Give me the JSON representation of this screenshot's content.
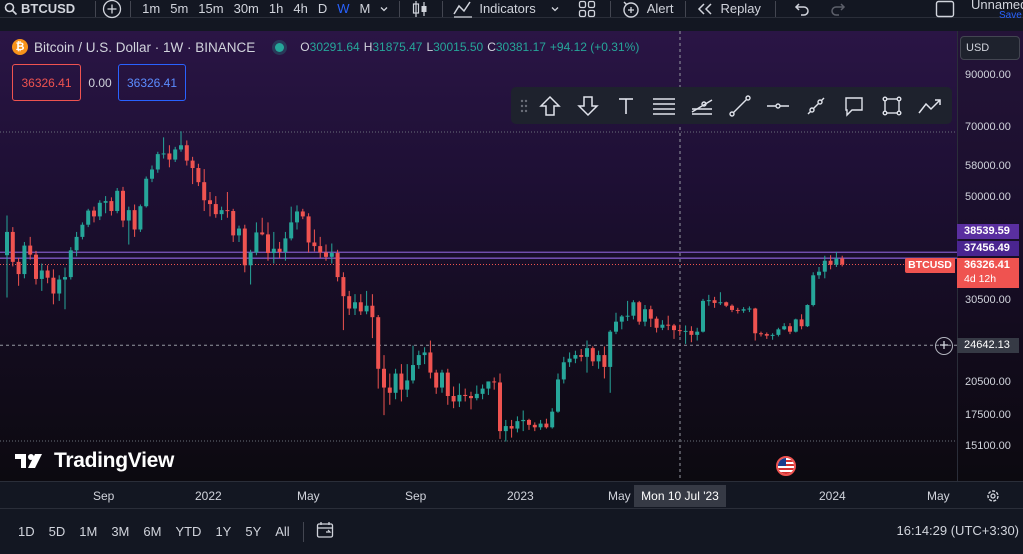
{
  "toolbar": {
    "symbol": "BTCUSD",
    "intervals": [
      "1m",
      "5m",
      "15m",
      "30m",
      "1h",
      "4h",
      "D",
      "W",
      "M"
    ],
    "active_interval": "W",
    "indicators_label": "Indicators",
    "alert_label": "Alert",
    "replay_label": "Replay",
    "layout_name": "Unnamed",
    "save_label": "Save"
  },
  "legend": {
    "coin_glyph": "₿",
    "title": "Bitcoin / U.S. Dollar · 1W · BINANCE",
    "open_key": "O",
    "open": "30291.64",
    "high_key": "H",
    "high": "31875.47",
    "low_key": "L",
    "low": "30015.50",
    "close_key": "C",
    "close": "30381.17",
    "change": "+94.12 (+0.31%)"
  },
  "order": {
    "sell": "36326.41",
    "spread": "0.00",
    "buy": "36326.41"
  },
  "currency": "USD",
  "price_axis": {
    "labels": [
      "90000.00",
      "70000.00",
      "58000.00",
      "50000.00",
      "30500.00",
      "20500.00",
      "17500.00",
      "15100.00"
    ],
    "tag_upper": "38539.59",
    "tag_lower": "37456.49",
    "tag_symbol": "BTCUSD",
    "tag_price": "36326.41",
    "tag_countdown": "4d 12h",
    "crosshair_price": "24642.13"
  },
  "brand": "TradingView",
  "time_axis": {
    "labels": [
      "Sep",
      "2022",
      "May",
      "Sep",
      "2023",
      "May",
      "2024",
      "May"
    ],
    "crosshair_label": "Mon 10 Jul '23"
  },
  "bottom": {
    "ranges": [
      "1D",
      "5D",
      "1M",
      "3M",
      "6M",
      "YTD",
      "1Y",
      "5Y",
      "All"
    ],
    "clock": "16:14:29 (UTC+3:30)"
  },
  "colors": {
    "up": "#26a69a",
    "down": "#ef5350",
    "accent": "#2962ff",
    "level_line": "#7e57c2"
  },
  "chart_data": {
    "type": "candlestick",
    "symbol": "BTCUSD",
    "interval": "1W",
    "scale": "log",
    "ylim": [
      15100,
      90000
    ],
    "candles": [
      {
        "o": 38000,
        "h": 46000,
        "l": 31000,
        "c": 42500
      },
      {
        "o": 42500,
        "h": 43500,
        "l": 36000,
        "c": 36800
      },
      {
        "o": 36800,
        "h": 37500,
        "l": 32800,
        "c": 34700
      },
      {
        "o": 34700,
        "h": 40500,
        "l": 34000,
        "c": 39800
      },
      {
        "o": 39800,
        "h": 41500,
        "l": 37200,
        "c": 38100
      },
      {
        "o": 38100,
        "h": 38800,
        "l": 33000,
        "c": 33900
      },
      {
        "o": 33900,
        "h": 36500,
        "l": 32000,
        "c": 35300
      },
      {
        "o": 35300,
        "h": 36200,
        "l": 33200,
        "c": 34100
      },
      {
        "o": 34100,
        "h": 35500,
        "l": 30000,
        "c": 31600
      },
      {
        "o": 31600,
        "h": 34500,
        "l": 30500,
        "c": 33800
      },
      {
        "o": 33800,
        "h": 35800,
        "l": 29300,
        "c": 34200
      },
      {
        "o": 34200,
        "h": 39500,
        "l": 33800,
        "c": 38900
      },
      {
        "o": 38900,
        "h": 42500,
        "l": 37800,
        "c": 41500
      },
      {
        "o": 41500,
        "h": 44500,
        "l": 41000,
        "c": 44000
      },
      {
        "o": 44000,
        "h": 47500,
        "l": 43500,
        "c": 47100
      },
      {
        "o": 47100,
        "h": 48000,
        "l": 44500,
        "c": 45800
      },
      {
        "o": 45800,
        "h": 49500,
        "l": 45000,
        "c": 48900
      },
      {
        "o": 48900,
        "h": 50500,
        "l": 46500,
        "c": 49300
      },
      {
        "o": 49300,
        "h": 50200,
        "l": 46000,
        "c": 47000
      },
      {
        "o": 47000,
        "h": 52500,
        "l": 46500,
        "c": 51800
      },
      {
        "o": 51800,
        "h": 52800,
        "l": 43500,
        "c": 44900
      },
      {
        "o": 44900,
        "h": 48000,
        "l": 40000,
        "c": 47200
      },
      {
        "o": 47200,
        "h": 48500,
        "l": 41500,
        "c": 43000
      },
      {
        "o": 43000,
        "h": 48500,
        "l": 42500,
        "c": 48100
      },
      {
        "o": 48100,
        "h": 55500,
        "l": 47800,
        "c": 54900
      },
      {
        "o": 54900,
        "h": 58500,
        "l": 54000,
        "c": 57400
      },
      {
        "o": 57400,
        "h": 62500,
        "l": 56500,
        "c": 61800
      },
      {
        "o": 61800,
        "h": 67000,
        "l": 60500,
        "c": 62000
      },
      {
        "o": 62000,
        "h": 64500,
        "l": 58000,
        "c": 60200
      },
      {
        "o": 60200,
        "h": 64000,
        "l": 59500,
        "c": 63200
      },
      {
        "o": 63200,
        "h": 69000,
        "l": 62500,
        "c": 64500
      },
      {
        "o": 64500,
        "h": 66000,
        "l": 58500,
        "c": 59900
      },
      {
        "o": 59900,
        "h": 61000,
        "l": 53500,
        "c": 57800
      },
      {
        "o": 57800,
        "h": 59000,
        "l": 53000,
        "c": 54000
      },
      {
        "o": 54000,
        "h": 57500,
        "l": 47000,
        "c": 49500
      },
      {
        "o": 49500,
        "h": 51500,
        "l": 45800,
        "c": 48600
      },
      {
        "o": 48600,
        "h": 50500,
        "l": 45500,
        "c": 46300
      },
      {
        "o": 46300,
        "h": 48000,
        "l": 45000,
        "c": 47200
      },
      {
        "o": 47200,
        "h": 51500,
        "l": 45500,
        "c": 47000
      },
      {
        "o": 47000,
        "h": 47500,
        "l": 40500,
        "c": 41800
      },
      {
        "o": 41800,
        "h": 43800,
        "l": 40500,
        "c": 43200
      },
      {
        "o": 43200,
        "h": 44000,
        "l": 35000,
        "c": 36200
      },
      {
        "o": 36200,
        "h": 39000,
        "l": 33000,
        "c": 38500
      },
      {
        "o": 38500,
        "h": 44500,
        "l": 38000,
        "c": 42400
      },
      {
        "o": 42400,
        "h": 45500,
        "l": 41800,
        "c": 42000
      },
      {
        "o": 42000,
        "h": 44500,
        "l": 37000,
        "c": 38400
      },
      {
        "o": 38400,
        "h": 42500,
        "l": 36500,
        "c": 39200
      },
      {
        "o": 39200,
        "h": 40500,
        "l": 37500,
        "c": 38600
      },
      {
        "o": 38600,
        "h": 42500,
        "l": 37000,
        "c": 41200
      },
      {
        "o": 41200,
        "h": 48000,
        "l": 40800,
        "c": 44500
      },
      {
        "o": 44500,
        "h": 48300,
        "l": 43000,
        "c": 46900
      },
      {
        "o": 46900,
        "h": 47500,
        "l": 45200,
        "c": 45800
      },
      {
        "o": 45800,
        "h": 46500,
        "l": 38500,
        "c": 40400
      },
      {
        "o": 40400,
        "h": 43000,
        "l": 38700,
        "c": 39700
      },
      {
        "o": 39700,
        "h": 41500,
        "l": 37500,
        "c": 38500
      },
      {
        "o": 38500,
        "h": 40000,
        "l": 37000,
        "c": 37700
      },
      {
        "o": 37700,
        "h": 40200,
        "l": 36500,
        "c": 38400
      },
      {
        "o": 38400,
        "h": 39000,
        "l": 33500,
        "c": 34200
      },
      {
        "o": 34200,
        "h": 35000,
        "l": 26500,
        "c": 31200
      },
      {
        "o": 31200,
        "h": 32000,
        "l": 28500,
        "c": 29400
      },
      {
        "o": 29400,
        "h": 31500,
        "l": 28500,
        "c": 30300
      },
      {
        "o": 30300,
        "h": 31500,
        "l": 28500,
        "c": 29000
      },
      {
        "o": 29000,
        "h": 32000,
        "l": 28600,
        "c": 29800
      },
      {
        "o": 29800,
        "h": 31500,
        "l": 25500,
        "c": 28200
      },
      {
        "o": 28200,
        "h": 28500,
        "l": 20000,
        "c": 22000
      },
      {
        "o": 22000,
        "h": 23500,
        "l": 17600,
        "c": 20100
      },
      {
        "o": 20100,
        "h": 21500,
        "l": 18500,
        "c": 19600
      },
      {
        "o": 19600,
        "h": 22000,
        "l": 19000,
        "c": 21500
      },
      {
        "o": 21500,
        "h": 22500,
        "l": 18800,
        "c": 19900
      },
      {
        "o": 19900,
        "h": 22500,
        "l": 19200,
        "c": 20800
      },
      {
        "o": 20800,
        "h": 24600,
        "l": 20500,
        "c": 22400
      },
      {
        "o": 22400,
        "h": 24000,
        "l": 22000,
        "c": 23500
      },
      {
        "o": 23500,
        "h": 24400,
        "l": 22500,
        "c": 23800
      },
      {
        "o": 23800,
        "h": 25200,
        "l": 21000,
        "c": 21600
      },
      {
        "o": 21600,
        "h": 21900,
        "l": 19500,
        "c": 20100
      },
      {
        "o": 20100,
        "h": 21900,
        "l": 19600,
        "c": 21600
      },
      {
        "o": 21600,
        "h": 22000,
        "l": 18500,
        "c": 19300
      },
      {
        "o": 19300,
        "h": 20200,
        "l": 18200,
        "c": 18800
      },
      {
        "o": 18800,
        "h": 20500,
        "l": 18300,
        "c": 19400
      },
      {
        "o": 19400,
        "h": 20000,
        "l": 18800,
        "c": 19300
      },
      {
        "o": 19300,
        "h": 19700,
        "l": 18100,
        "c": 19100
      },
      {
        "o": 19100,
        "h": 20300,
        "l": 18900,
        "c": 19500
      },
      {
        "o": 19500,
        "h": 20400,
        "l": 19000,
        "c": 20000
      },
      {
        "o": 20000,
        "h": 20700,
        "l": 19400,
        "c": 20700
      },
      {
        "o": 20700,
        "h": 21100,
        "l": 19900,
        "c": 20600
      },
      {
        "o": 20600,
        "h": 21500,
        "l": 15700,
        "c": 16300
      },
      {
        "o": 16300,
        "h": 17200,
        "l": 15500,
        "c": 16700
      },
      {
        "o": 16700,
        "h": 17200,
        "l": 15800,
        "c": 16500
      },
      {
        "o": 16500,
        "h": 17500,
        "l": 16200,
        "c": 17100
      },
      {
        "o": 17100,
        "h": 18000,
        "l": 16300,
        "c": 17200
      },
      {
        "o": 17200,
        "h": 17300,
        "l": 16400,
        "c": 16800
      },
      {
        "o": 16800,
        "h": 17000,
        "l": 16300,
        "c": 16600
      },
      {
        "o": 16600,
        "h": 17200,
        "l": 16400,
        "c": 16900
      },
      {
        "o": 16900,
        "h": 17300,
        "l": 16500,
        "c": 16600
      },
      {
        "o": 16600,
        "h": 18200,
        "l": 16500,
        "c": 17900
      },
      {
        "o": 17900,
        "h": 21500,
        "l": 17800,
        "c": 20900
      },
      {
        "o": 20900,
        "h": 23300,
        "l": 20500,
        "c": 22700
      },
      {
        "o": 22700,
        "h": 23800,
        "l": 22200,
        "c": 23100
      },
      {
        "o": 23100,
        "h": 24000,
        "l": 22600,
        "c": 23500
      },
      {
        "o": 23500,
        "h": 24200,
        "l": 22800,
        "c": 23300
      },
      {
        "o": 23300,
        "h": 25200,
        "l": 21600,
        "c": 24300
      },
      {
        "o": 24300,
        "h": 24500,
        "l": 22300,
        "c": 22800
      },
      {
        "o": 22800,
        "h": 24000,
        "l": 22000,
        "c": 23500
      },
      {
        "o": 23500,
        "h": 24500,
        "l": 21000,
        "c": 22200
      },
      {
        "o": 22200,
        "h": 26500,
        "l": 19600,
        "c": 26300
      },
      {
        "o": 26300,
        "h": 28800,
        "l": 26000,
        "c": 27600
      },
      {
        "o": 27600,
        "h": 28500,
        "l": 26600,
        "c": 28300
      },
      {
        "o": 28300,
        "h": 30500,
        "l": 27700,
        "c": 28400
      },
      {
        "o": 28400,
        "h": 30600,
        "l": 27900,
        "c": 30300
      },
      {
        "o": 30300,
        "h": 30500,
        "l": 27200,
        "c": 27600
      },
      {
        "o": 27600,
        "h": 29900,
        "l": 27000,
        "c": 29300
      },
      {
        "o": 29300,
        "h": 29800,
        "l": 26900,
        "c": 28000
      },
      {
        "o": 28000,
        "h": 28300,
        "l": 26200,
        "c": 26800
      },
      {
        "o": 26800,
        "h": 27800,
        "l": 26500,
        "c": 27200
      },
      {
        "o": 27200,
        "h": 28400,
        "l": 26500,
        "c": 27100
      },
      {
        "o": 27100,
        "h": 27300,
        "l": 25400,
        "c": 26500
      },
      {
        "o": 26500,
        "h": 27200,
        "l": 25800,
        "c": 26400
      },
      {
        "o": 26400,
        "h": 27100,
        "l": 24800,
        "c": 26400
      },
      {
        "o": 26400,
        "h": 27000,
        "l": 25000,
        "c": 25900
      },
      {
        "o": 25900,
        "h": 26800,
        "l": 25200,
        "c": 26300
      },
      {
        "o": 26300,
        "h": 30800,
        "l": 26200,
        "c": 30500
      },
      {
        "o": 30500,
        "h": 31400,
        "l": 29800,
        "c": 30600
      },
      {
        "o": 30600,
        "h": 31100,
        "l": 29500,
        "c": 30200
      },
      {
        "o": 30200,
        "h": 31800,
        "l": 29900,
        "c": 30300
      },
      {
        "o": 30300,
        "h": 30400,
        "l": 29600,
        "c": 29800
      },
      {
        "o": 29800,
        "h": 30000,
        "l": 28900,
        "c": 29200
      },
      {
        "o": 29200,
        "h": 29500,
        "l": 28700,
        "c": 29100
      },
      {
        "o": 29100,
        "h": 29600,
        "l": 28800,
        "c": 29300
      },
      {
        "o": 29300,
        "h": 29700,
        "l": 28900,
        "c": 29400
      },
      {
        "o": 29400,
        "h": 29500,
        "l": 25200,
        "c": 26100
      },
      {
        "o": 26100,
        "h": 26300,
        "l": 25700,
        "c": 26000
      },
      {
        "o": 26000,
        "h": 26200,
        "l": 25400,
        "c": 25800
      },
      {
        "o": 25800,
        "h": 26100,
        "l": 25300,
        "c": 25900
      },
      {
        "o": 25900,
        "h": 26800,
        "l": 25700,
        "c": 26600
      },
      {
        "o": 26600,
        "h": 27400,
        "l": 26500,
        "c": 27000
      },
      {
        "o": 27000,
        "h": 27400,
        "l": 26000,
        "c": 26300
      },
      {
        "o": 26300,
        "h": 28000,
        "l": 26200,
        "c": 27900
      },
      {
        "o": 27900,
        "h": 28600,
        "l": 26600,
        "c": 27000
      },
      {
        "o": 27000,
        "h": 30000,
        "l": 26900,
        "c": 29900
      },
      {
        "o": 29900,
        "h": 35000,
        "l": 29700,
        "c": 34500
      },
      {
        "o": 34500,
        "h": 35900,
        "l": 33900,
        "c": 35100
      },
      {
        "o": 35100,
        "h": 37900,
        "l": 34000,
        "c": 37000
      },
      {
        "o": 37000,
        "h": 38000,
        "l": 35500,
        "c": 36300
      },
      {
        "o": 36300,
        "h": 38600,
        "l": 35900,
        "c": 37400
      },
      {
        "o": 37400,
        "h": 37900,
        "l": 36000,
        "c": 36326.41
      }
    ]
  }
}
